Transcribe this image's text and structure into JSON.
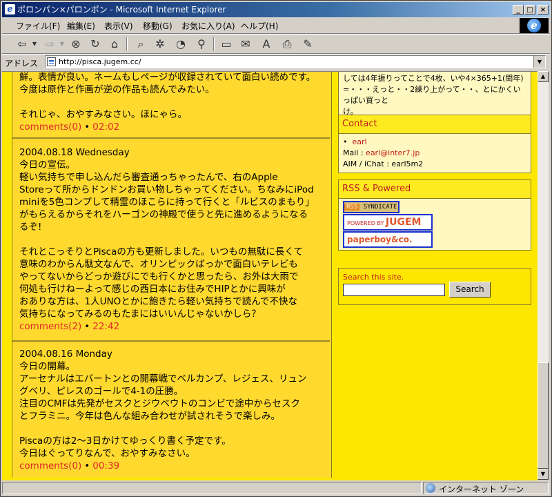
{
  "window": {
    "title": "ポロンパン×パロンポン - Microsoft Internet Explorer",
    "minimize": "_",
    "maximize": "□",
    "close": "×"
  },
  "menu": [
    "ファイル(F)",
    "編集(E)",
    "表示(V)",
    "移動(G)",
    "お気に入り(A)",
    "ヘルプ(H)"
  ],
  "address": {
    "label": "アドレス",
    "url": "http://pisca.jugem.cc/"
  },
  "entries": [
    {
      "date": "",
      "lines": [
        "鮮。表情が良い。ネームもしページが収録されていて面白い読めです。",
        "今度は原作と作画が逆の作品も読んでみたい。",
        "",
        "それじゃ、おやすみなさい。ほにゃら。"
      ],
      "comments": "comments(0)",
      "time": "02:02"
    },
    {
      "date": "2004.08.18 Wednesday",
      "lines": [
        "今日の宣伝。",
        "軽い気持ちで申し込んだら審査通っちゃったんで、右のApple",
        "Storeって所からドンドンお買い物しちゃってください。ちなみにiPod",
        "miniを5色コンプして精霊のほこらに持って行くと「ルビスのまもり」",
        "がもらえるからそれをハーゴンの神殿で使うと先に進めるようになる",
        "るぞ!",
        "",
        "それとこっそりとPiscaの方も更新しました。いつもの無駄に長くて",
        "意味のわからん駄文なんで、オリンピックばっかで面白いテレビも",
        "やってないからどっか遊びにでも行くかと思ったら、お外は大雨で",
        "何処も行けねーよって感じの西日本にお住みでHIPとかに興味が",
        "おありな方は、1人UNOとかに飽きたら軽い気持ちで読んで不快な",
        "気持ちになってみるのもたまにはいいんじゃないかしら？"
      ],
      "comments": "comments(2)",
      "time": "22:42"
    },
    {
      "date": "2004.08.16 Monday",
      "lines": [
        "今日の開幕。",
        "アーセナルはエバートンとの開幕戦でベルカンプ、レジェス、リュン",
        "グベリ、ピレスのゴールで4-1の圧勝。",
        "注目のCMFは先発がセスクとジウベウトのコンビで途中からセスク",
        "とフラミニ。今年は色んな組み合わせが試されそうで楽しみ。",
        "",
        "Piscaの方は2〜3日かけてゆっくり書く予定です。",
        "今日はぐってりなんで、おやすみなさい。"
      ],
      "comments": "comments(0)",
      "time": "00:39"
    }
  ],
  "sidebar": {
    "topbox": {
      "lines": [
        "しては4年振りってことで4枚、いや4×365+1(閏年)",
        "=・・・えっと・・2繰り上がって・・、とにかくいっぱい買っと",
        "け。"
      ]
    },
    "contact": {
      "title": "Contact",
      "name": "earl",
      "mail_label": "Mail : ",
      "mail": "earl@inter7.jp",
      "aim": "AIM / iChat : earl5m2"
    },
    "rss": {
      "title": "RSS & Powered",
      "rss_badge_a": "RSS",
      "rss_badge_b": "SYNDICATE",
      "jugem_badge_a": "POWERED BY",
      "jugem_badge_b": "JUGEM",
      "pb_badge": "paperboy&co."
    },
    "search": {
      "label": "Search this site.",
      "button": "Search",
      "value": ""
    }
  },
  "status": {
    "zone": "インターネット ゾーン"
  }
}
